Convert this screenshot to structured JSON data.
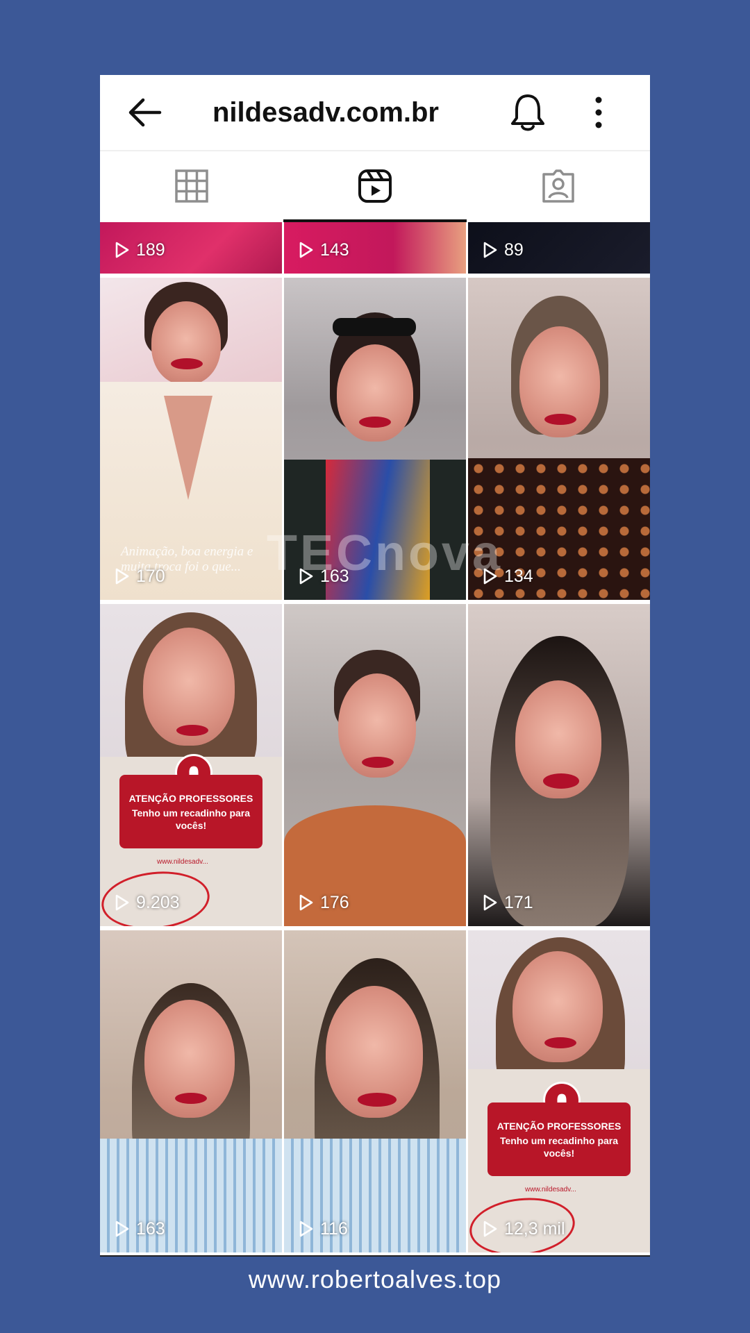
{
  "header": {
    "title": "nildesadv.com.br",
    "back_icon": "arrow-left-icon",
    "notifications_icon": "bell-icon",
    "more_icon": "more-vertical-icon"
  },
  "tabs": [
    {
      "name": "posts-grid",
      "icon": "grid-icon",
      "selected": false
    },
    {
      "name": "reels",
      "icon": "reels-icon",
      "selected": true
    },
    {
      "name": "tagged",
      "icon": "tagged-person-icon",
      "selected": false
    }
  ],
  "reels": [
    {
      "views": "189"
    },
    {
      "views": "143"
    },
    {
      "views": "89"
    },
    {
      "views": "170",
      "caption": "Animação, boa energia e muita troca foi o que..."
    },
    {
      "views": "163"
    },
    {
      "views": "134"
    },
    {
      "views": "9.203",
      "banner_line1": "ATENÇÃO PROFESSORES",
      "banner_line2": "Tenho um recadinho para vocês!",
      "banner_url": "www.nildesadv..."
    },
    {
      "views": "176"
    },
    {
      "views": "171"
    },
    {
      "views": "163"
    },
    {
      "views": "116"
    },
    {
      "views": "12,3 mil",
      "banner_line1": "ATENÇÃO PROFESSORES",
      "banner_line2": "Tenho um recadinho para vocês!",
      "banner_url": "www.nildesadv..."
    }
  ],
  "watermark": "TECnova",
  "footer": "www.robertoalves.top",
  "colors": {
    "page_background": "#3c5897",
    "banner_red": "#b81628",
    "annotation_red": "#d11f2a"
  }
}
